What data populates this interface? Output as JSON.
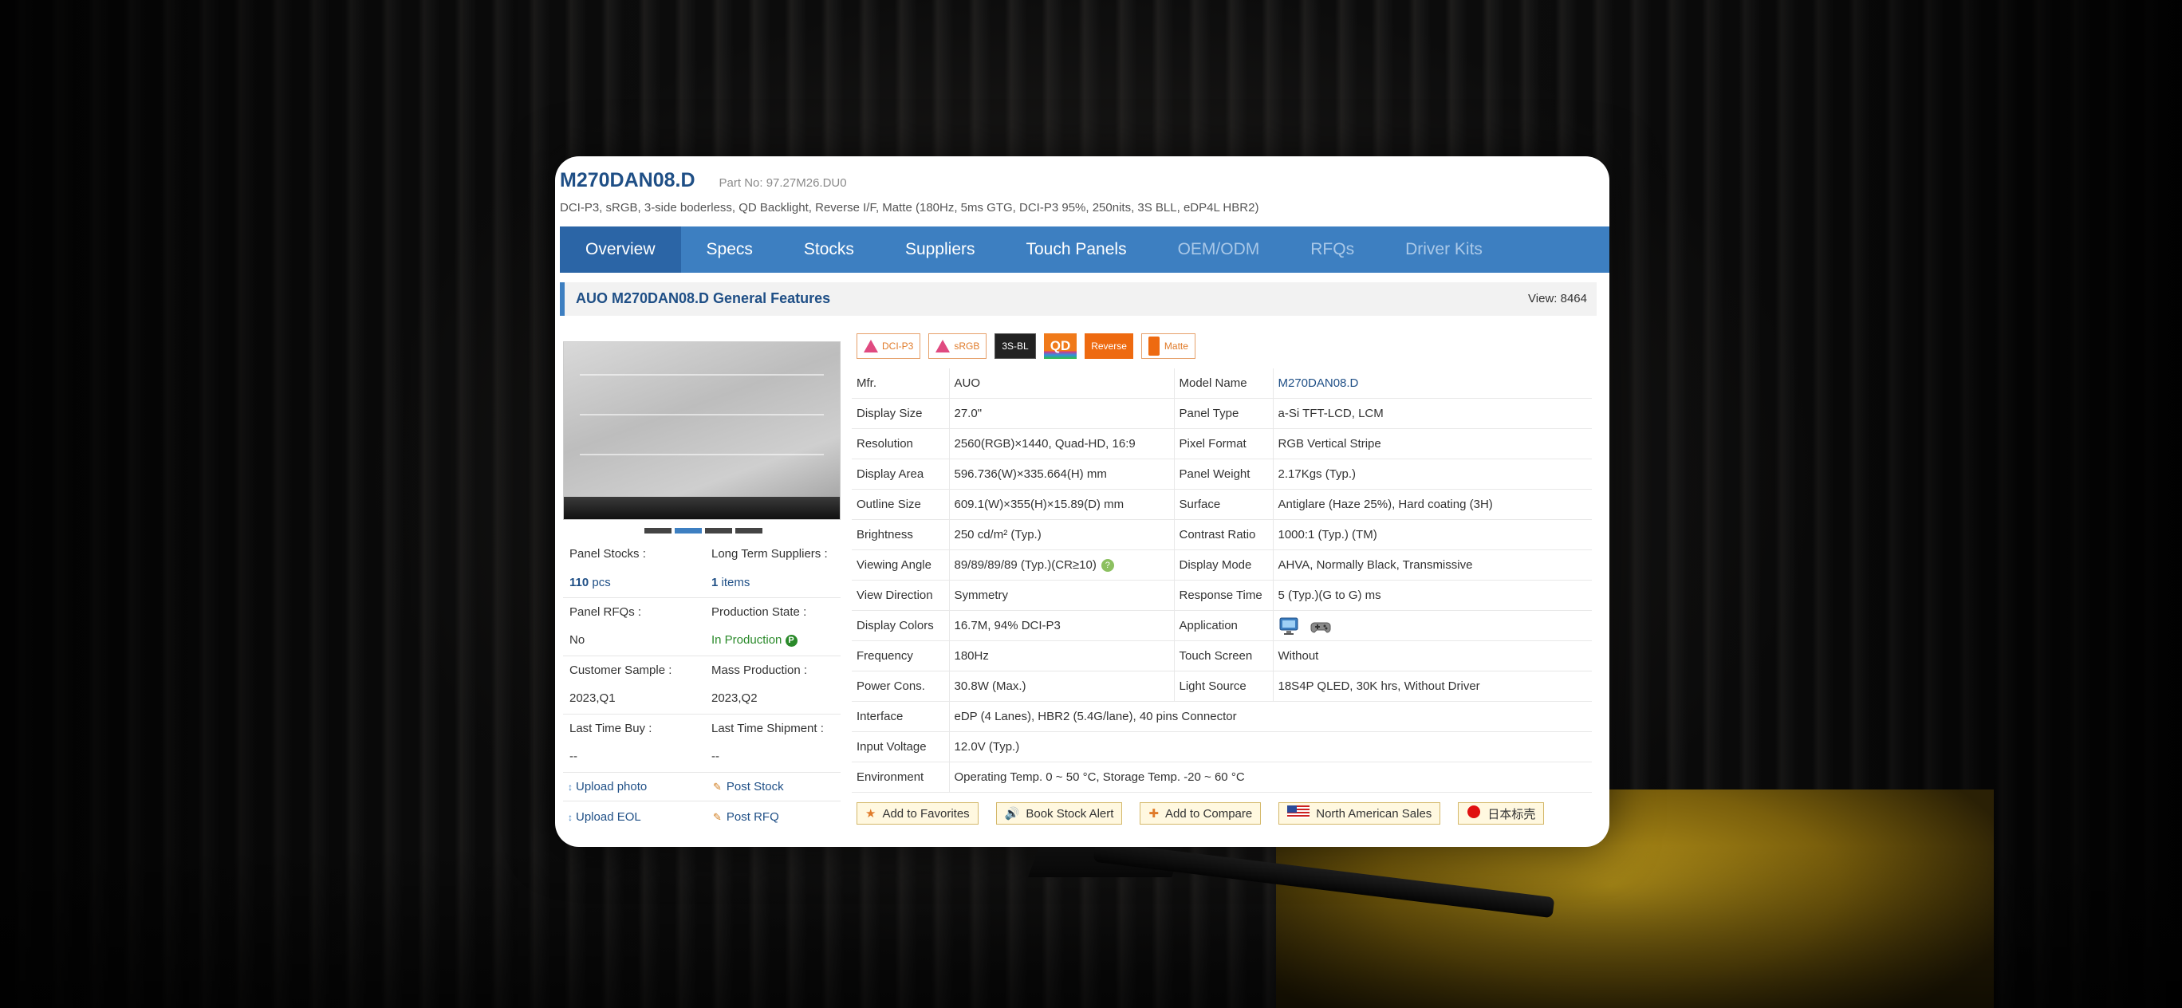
{
  "model": {
    "title": "M270DAN08.D",
    "part_no": "Part No: 97.27M26.DU0",
    "subtitle": "DCI-P3, sRGB, 3-side boderless, QD Backlight, Reverse I/F, Matte  (180Hz, 5ms GTG, DCI-P3 95%, 250nits, 3S BLL, eDP4L HBR2)"
  },
  "tabs": [
    {
      "label": "Overview",
      "state": "active"
    },
    {
      "label": "Specs",
      "state": "normal"
    },
    {
      "label": "Stocks",
      "state": "normal"
    },
    {
      "label": "Suppliers",
      "state": "normal"
    },
    {
      "label": "Touch Panels",
      "state": "normal"
    },
    {
      "label": "OEM/ODM",
      "state": "muted"
    },
    {
      "label": "RFQs",
      "state": "muted"
    },
    {
      "label": "Driver Kits",
      "state": "muted"
    }
  ],
  "section": {
    "title": "AUO M270DAN08.D General Features",
    "view_count": "View: 8464"
  },
  "badges": [
    {
      "label": "DCI-P3",
      "style": "outline",
      "icon": "color-triangle-icon"
    },
    {
      "label": "sRGB",
      "style": "outline",
      "icon": "color-triangle-icon"
    },
    {
      "label": "3S-BL",
      "style": "dark"
    },
    {
      "label": "QD",
      "style": "qd"
    },
    {
      "label": "Reverse",
      "style": "orange"
    },
    {
      "label": "Matte",
      "style": "outline",
      "icon": "matte-icon"
    }
  ],
  "stats": {
    "panel_stocks_label": "Panel Stocks :",
    "panel_stocks_value": "110",
    "panel_stocks_unit": " pcs",
    "long_term_label": "Long Term Suppliers :",
    "long_term_value": "1",
    "long_term_unit": " items",
    "rfqs_label": "Panel RFQs :",
    "rfqs_value": "No",
    "production_label": "Production State :",
    "production_value": "In Production",
    "production_badge": "P",
    "sample_label": "Customer Sample :",
    "sample_value": "2023,Q1",
    "mass_label": "Mass Production :",
    "mass_value": "2023,Q2",
    "last_buy_label": "Last Time Buy :",
    "last_buy_value": "--",
    "last_ship_label": "Last Time Shipment :",
    "last_ship_value": "--"
  },
  "links": {
    "upload_photo": "Upload photo",
    "post_stock": "Post Stock",
    "upload_eol": "Upload EOL",
    "post_rfq": "Post RFQ"
  },
  "specs": [
    {
      "l1": "Mfr.",
      "v1": "AUO",
      "l2": "Model Name",
      "v2": "M270DAN08.D"
    },
    {
      "l1": "Display Size",
      "v1": "27.0\"",
      "l2": "Panel Type",
      "v2": "a-Si TFT-LCD, LCM"
    },
    {
      "l1": "Resolution",
      "v1": "2560(RGB)×1440, Quad-HD, 16:9",
      "l2": "Pixel Format",
      "v2": "RGB Vertical Stripe"
    },
    {
      "l1": "Display Area",
      "v1": "596.736(W)×335.664(H) mm",
      "l2": "Panel Weight",
      "v2": "2.17Kgs (Typ.)"
    },
    {
      "l1": "Outline Size",
      "v1": "609.1(W)×355(H)×15.89(D) mm",
      "l2": "Surface",
      "v2": "Antiglare (Haze 25%), Hard coating (3H)"
    },
    {
      "l1": "Brightness",
      "v1": "250 cd/m² (Typ.)",
      "l2": "Contrast Ratio",
      "v2": "1000:1 (Typ.) (TM)"
    },
    {
      "l1": "Viewing Angle",
      "v1": "89/89/89/89 (Typ.)(CR≥10)",
      "l2": "Display Mode",
      "v2": "AHVA, Normally Black, Transmissive"
    },
    {
      "l1": "View Direction",
      "v1": "Symmetry",
      "l2": "Response Time",
      "v2": "5 (Typ.)(G to G) ms"
    },
    {
      "l1": "Display Colors",
      "v1": "16.7M, 94% DCI-P3",
      "l2": "Application",
      "v2": ""
    },
    {
      "l1": "Frequency",
      "v1": "180Hz",
      "l2": "Touch Screen",
      "v2": "Without"
    },
    {
      "l1": "Power Cons.",
      "v1": "30.8W (Max.)",
      "l2": "Light Source",
      "v2": "18S4P QLED, 30K hrs, Without Driver"
    }
  ],
  "specs_wide": [
    {
      "l": "Interface",
      "v": "eDP (4 Lanes), HBR2 (5.4G/lane), 40 pins Connector"
    },
    {
      "l": "Input Voltage",
      "v": "12.0V (Typ.)"
    },
    {
      "l": "Environment",
      "v": "Operating Temp. 0 ~ 50 °C, Storage Temp. -20 ~ 60 °C"
    }
  ],
  "viewing_angle_help": "?",
  "buttons": {
    "favorites": "Add to Favorites",
    "stock_alert": "Book Stock Alert",
    "compare": "Add to Compare",
    "na_sales": "North American Sales",
    "japan": "日本标壳"
  },
  "colors": {
    "brand_blue": "#3d7fc1",
    "title_blue": "#1f4f86",
    "accent_orange": "#ee6a10",
    "status_green": "#2a8a2a"
  }
}
